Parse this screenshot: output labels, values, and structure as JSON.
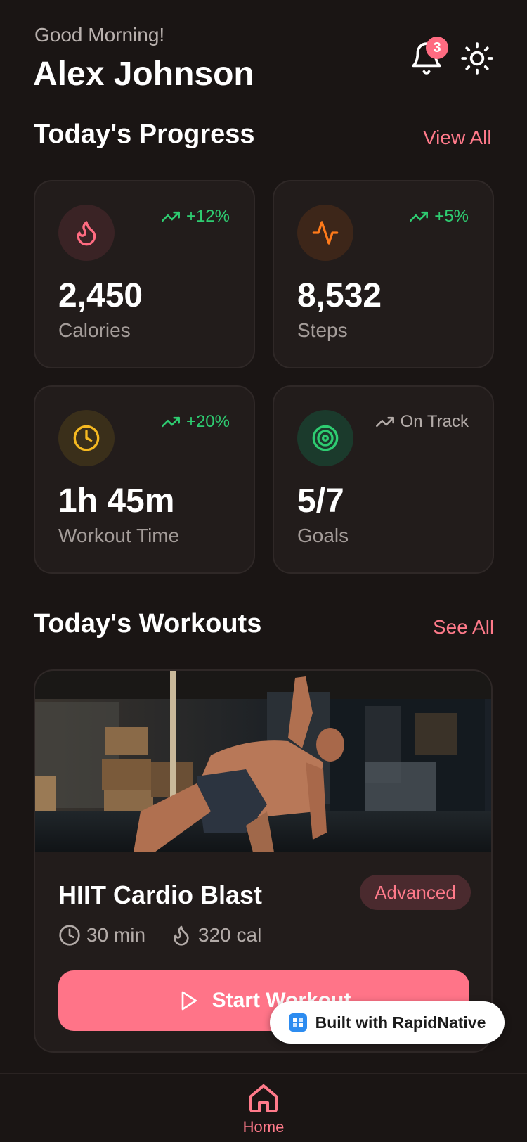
{
  "header": {
    "greeting": "Good Morning!",
    "user_name": "Alex Johnson",
    "notifications_count": "3"
  },
  "progress": {
    "title": "Today's Progress",
    "link": "View All",
    "cards": [
      {
        "value": "2,450",
        "label": "Calories",
        "trend": "+12%",
        "icon": "flame-icon",
        "trend_color": "#2ecc71",
        "accent": "#ff6b81"
      },
      {
        "value": "8,532",
        "label": "Steps",
        "trend": "+5%",
        "icon": "activity-icon",
        "trend_color": "#2ecc71",
        "accent": "#ff7a1a"
      },
      {
        "value": "1h 45m",
        "label": "Workout Time",
        "trend": "+20%",
        "icon": "clock-icon",
        "trend_color": "#2ecc71",
        "accent": "#f5b921"
      },
      {
        "value": "5/7",
        "label": "Goals",
        "trend": "On Track",
        "icon": "target-icon",
        "trend_color": "#b3aba8",
        "accent": "#2ecc71"
      }
    ]
  },
  "workouts": {
    "title": "Today's Workouts",
    "link": "See All",
    "featured": {
      "name": "HIIT Cardio Blast",
      "level": "Advanced",
      "duration": "30 min",
      "calories": "320 cal",
      "cta": "Start Workout"
    }
  },
  "badge": {
    "text": "Built with RapidNative"
  },
  "nav": {
    "home_label": "Home",
    "active_color": "#ff7a8a"
  }
}
